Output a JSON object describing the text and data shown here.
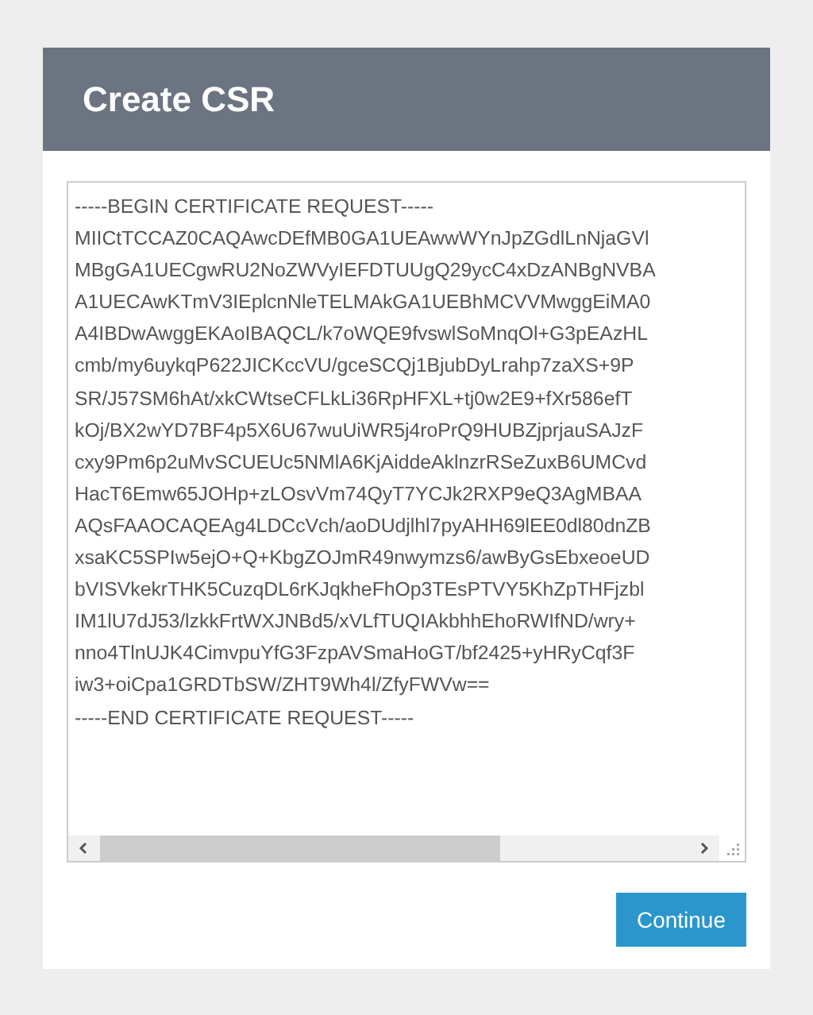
{
  "dialog": {
    "title": "Create CSR"
  },
  "csr_field": {
    "lines": [
      "-----BEGIN CERTIFICATE REQUEST-----",
      "MIICtTCCAZ0CAQAwcDEfMB0GA1UEAwwWYnJpZGdlLnNjaGVl",
      "MBgGA1UECgwRU2NoZWVyIEFDTUUgQ29ycC4xDzANBgNVBA",
      "A1UECAwKTmV3IEplcnNleTELMAkGA1UEBhMCVVMwggEiMA0",
      "A4IBDwAwggEKAoIBAQCL/k7oWQE9fvswlSoMnqOl+G3pEAzHL",
      "cmb/my6uykqP622JICKccVU/gceSCQj1BjubDyLrahp7zaXS+9P",
      "SR/J57SM6hAt/xkCWtseCFLkLi36RpHFXL+tj0w2E9+fXr586efT",
      "kOj/BX2wYD7BF4p5X6U67wuUiWR5j4roPrQ9HUBZjprjauSAJzF",
      "cxy9Pm6p2uMvSCUEUc5NMlA6KjAiddeAklnzrRSeZuxB6UMCvd",
      "HacT6Emw65JOHp+zLOsvVm74QyT7YCJk2RXP9eQ3AgMBAA",
      "AQsFAAOCAQEAg4LDCcVch/aoDUdjlhl7pyAHH69lEE0dl80dnZB",
      "xsaKC5SPIw5ejO+Q+KbgZOJmR49nwymzs6/awByGsEbxeoeUD",
      "bVISVkekrTHK5CuzqDL6rKJqkheFhOp3TEsPTVY5KhZpTHFjzbl",
      "IM1lU7dJ53/lzkkFrtWXJNBd5/xVLfTUQIAkbhhEhoRWIfND/wry+",
      "nno4TlnUJK4CimvpuYfG3FzpAVSmaHoGT/bf2425+yHRyCqf3F",
      "iw3+oiCpa1GRDTbSW/ZHT9Wh4l/ZfyFWVw==",
      "-----END CERTIFICATE REQUEST-----"
    ]
  },
  "continue_button": {
    "label": "Continue"
  }
}
